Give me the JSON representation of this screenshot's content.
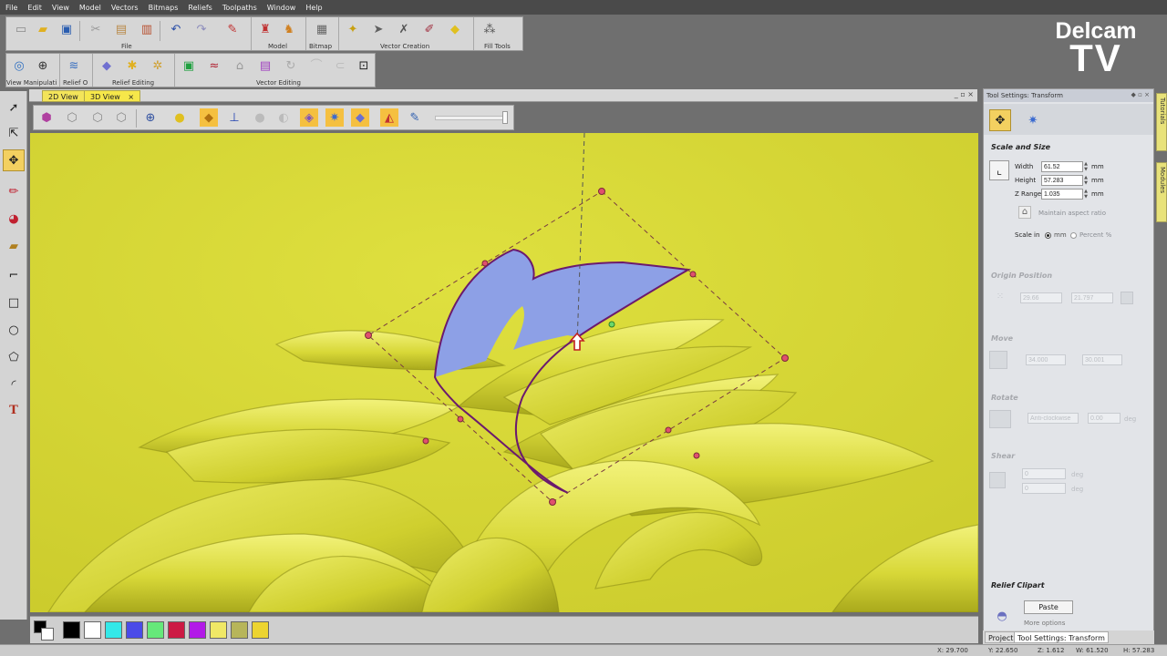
{
  "menu": [
    "File",
    "Edit",
    "View",
    "Model",
    "Vectors",
    "Bitmaps",
    "Reliefs",
    "Toolpaths",
    "Window",
    "Help"
  ],
  "logo": {
    "line1": "Delcam",
    "line2": "TV"
  },
  "toolbar_captions": {
    "file": "File",
    "model": "Model",
    "bitmap": "Bitmap",
    "vector_creation": "Vector Creation",
    "fill_tools": "Fill Tools",
    "view_manipulation": "View Manipulati",
    "relief_o": "Relief O",
    "relief_editing": "Relief Editing",
    "vector_editing": "Vector Editing"
  },
  "doc_tabs": {
    "tab1": "2D View",
    "tab2": "3D View",
    "close": "×",
    "window_buttons": "_ ▫ ×"
  },
  "panel": {
    "title": "Tool Settings: Transform",
    "controls": "◆ ▫ ×",
    "scale_title": "Scale and Size",
    "width_label": "Width",
    "width_value": "61.52",
    "height_label": "Height",
    "height_value": "57.283",
    "zrange_label": "Z Range",
    "zrange_value": "1.035",
    "unit": "mm",
    "maintain": "Maintain aspect ratio",
    "scale_in": "Scale in",
    "opt_mm": "mm",
    "opt_percent": "Percent %",
    "origin_title": "Origin Position",
    "origin_x": "29.66",
    "origin_y": "21.797",
    "move_title": "Move",
    "move_x": "34.000",
    "move_y": "30.001",
    "rotate_title": "Rotate",
    "rotate_dir": "Anti-clockwise",
    "rotate_value": "0.00",
    "rotate_unit": "deg",
    "shear_title": "Shear",
    "shear_x": "0",
    "shear_y": "0",
    "shear_unit": "deg",
    "clipart_title": "Relief Clipart",
    "paste": "Paste",
    "more": "More options"
  },
  "side_tabs": {
    "tutorials": "Tutorials",
    "modules": "Modules"
  },
  "bottom_tabs": {
    "project": "Project",
    "transform": "Tool Settings: Transform"
  },
  "status": {
    "x": "X: 29.700",
    "y": "Y: 22.650",
    "z": "Z: 1.612",
    "w": "W: 61.520",
    "h": "H: 57.283"
  },
  "palette": [
    "#000000",
    "#ffffff",
    "#33e8e8",
    "#4b4be8",
    "#66e87a",
    "#cc1a44",
    "#b21ae8",
    "#f0e866",
    "#b7b55a",
    "#ecd430"
  ],
  "colors": {
    "relief": "#d3d531",
    "selection": "#8da0e6",
    "vector": "#6b1a6e",
    "panel": "#e2e4e8"
  }
}
